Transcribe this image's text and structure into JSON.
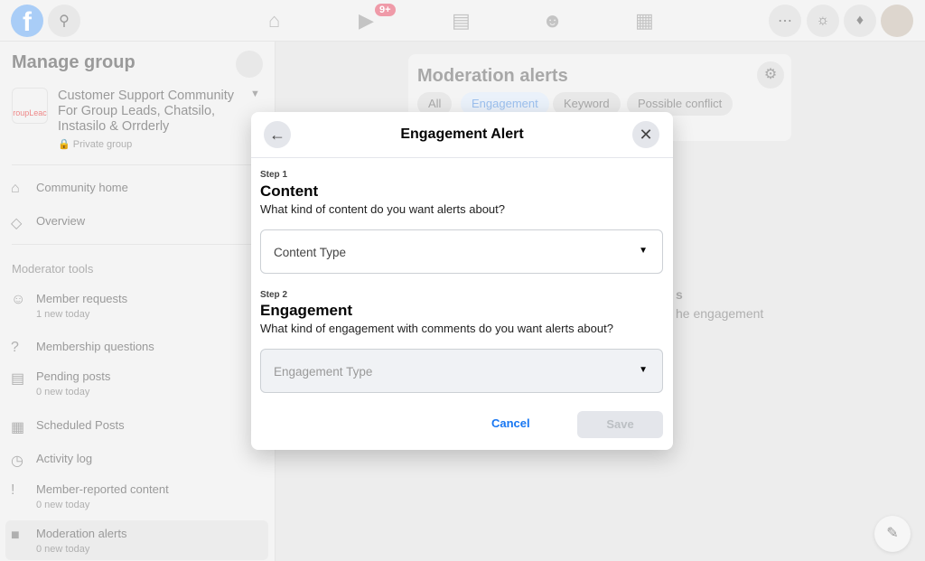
{
  "topbar": {
    "notification_badge": "9+"
  },
  "sidebar": {
    "title": "Manage group",
    "group_name": "Customer Support Community For Group Leads, Chatsilo, Instasilo & Orrderly",
    "group_logo_text": "roupLeac",
    "privacy": "Private group",
    "items": [
      {
        "label": "Community home"
      },
      {
        "label": "Overview"
      }
    ],
    "section": "Moderator tools",
    "tools": [
      {
        "label": "Member requests",
        "sub": "1 new today"
      },
      {
        "label": "Membership questions"
      },
      {
        "label": "Pending posts",
        "sub": "0 new today"
      },
      {
        "label": "Scheduled Posts"
      },
      {
        "label": "Activity log"
      },
      {
        "label": "Member-reported content",
        "sub": "0 new today"
      },
      {
        "label": "Moderation alerts",
        "sub": "0 new today"
      }
    ]
  },
  "main": {
    "title": "Moderation alerts",
    "chips": [
      "All",
      "Engagement",
      "Keyword",
      "Possible conflict"
    ],
    "behind_text_1": "s",
    "behind_text_2": "he engagement"
  },
  "modal": {
    "title": "Engagement Alert",
    "step1": {
      "step": "Step 1",
      "heading": "Content",
      "question": "What kind of content do you want alerts about?",
      "select": "Content Type"
    },
    "step2": {
      "step": "Step 2",
      "heading": "Engagement",
      "question": "What kind of engagement with comments do you want alerts about?",
      "select": "Engagement Type"
    },
    "cancel": "Cancel",
    "save": "Save"
  },
  "colors": {
    "accent": "#1877f2",
    "badge": "#e41e3f"
  }
}
